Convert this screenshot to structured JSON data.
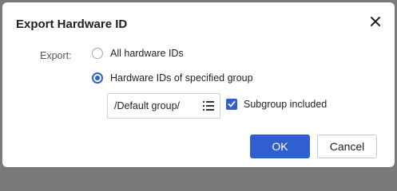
{
  "dialog": {
    "title": "Export Hardware ID"
  },
  "form": {
    "export_label": "Export:",
    "options": [
      {
        "label": "All hardware IDs",
        "selected": false
      },
      {
        "label": "Hardware IDs of specified group",
        "selected": true
      }
    ],
    "group_value": "/Default group/",
    "subgroup_label": "Subgroup included",
    "subgroup_checked": true
  },
  "buttons": {
    "ok": "OK",
    "cancel": "Cancel"
  },
  "icons": {
    "close": "close-icon",
    "group_picker": "list-icon",
    "checkmark": "checkmark-icon"
  },
  "colors": {
    "accent": "#2f5fd0"
  }
}
